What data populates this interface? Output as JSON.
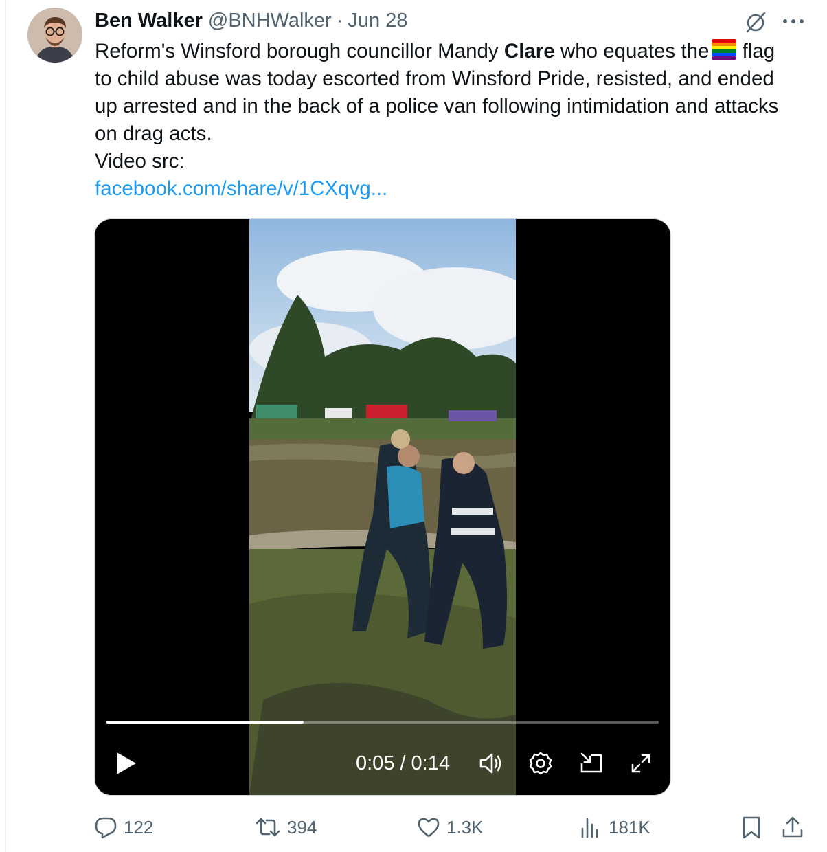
{
  "author": {
    "name": "Ben Walker",
    "handle": "@BNHWalker",
    "separator": "·",
    "date": "Jun 28"
  },
  "tweet": {
    "text_before_bold": "Reform's Winsford borough councillor Mandy ",
    "bold": "Clare",
    "text_after_bold": " who equates the",
    "flag_emoji": "rainbow-flag-icon",
    "text_continuation": " flag to child abuse was today escorted from Winsford Pride, resisted, and ended up arrested and in the back of a police van following intimidation and attacks on drag acts.",
    "video_src_label": "Video src:",
    "link_text": "facebook.com/share/v/1CXqvg..."
  },
  "video": {
    "current_time": "0:05",
    "time_separator": "/",
    "duration": "0:14",
    "progress_fraction": 0.357
  },
  "actions": {
    "replies": "122",
    "reposts": "394",
    "likes": "1.3K",
    "views": "181K"
  },
  "colors": {
    "link": "#1d9bf0",
    "secondary_text": "#536471"
  },
  "icons": [
    "grok-icon",
    "more-icon",
    "play-icon",
    "volume-icon",
    "settings-icon",
    "minimize-icon",
    "fullscreen-icon",
    "reply-icon",
    "repost-icon",
    "like-icon",
    "views-icon",
    "bookmark-icon",
    "share-icon"
  ]
}
